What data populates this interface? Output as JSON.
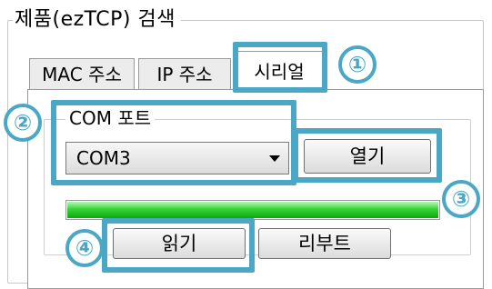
{
  "group_title": "제품(ezTCP) 검색",
  "tabs": [
    {
      "label": "MAC 주소",
      "active": false
    },
    {
      "label": "IP 주소",
      "active": false
    },
    {
      "label": "시리얼",
      "active": true
    }
  ],
  "com_port": {
    "label": "COM 포트",
    "selected": "COM3",
    "open_button": "열기"
  },
  "progress": {
    "value": 1.0,
    "color": "#2ecc2e"
  },
  "buttons": {
    "read": "읽기",
    "reboot": "리부트"
  },
  "callouts": [
    "①",
    "②",
    "③",
    "④"
  ],
  "accent_color": "#4aa7c5"
}
